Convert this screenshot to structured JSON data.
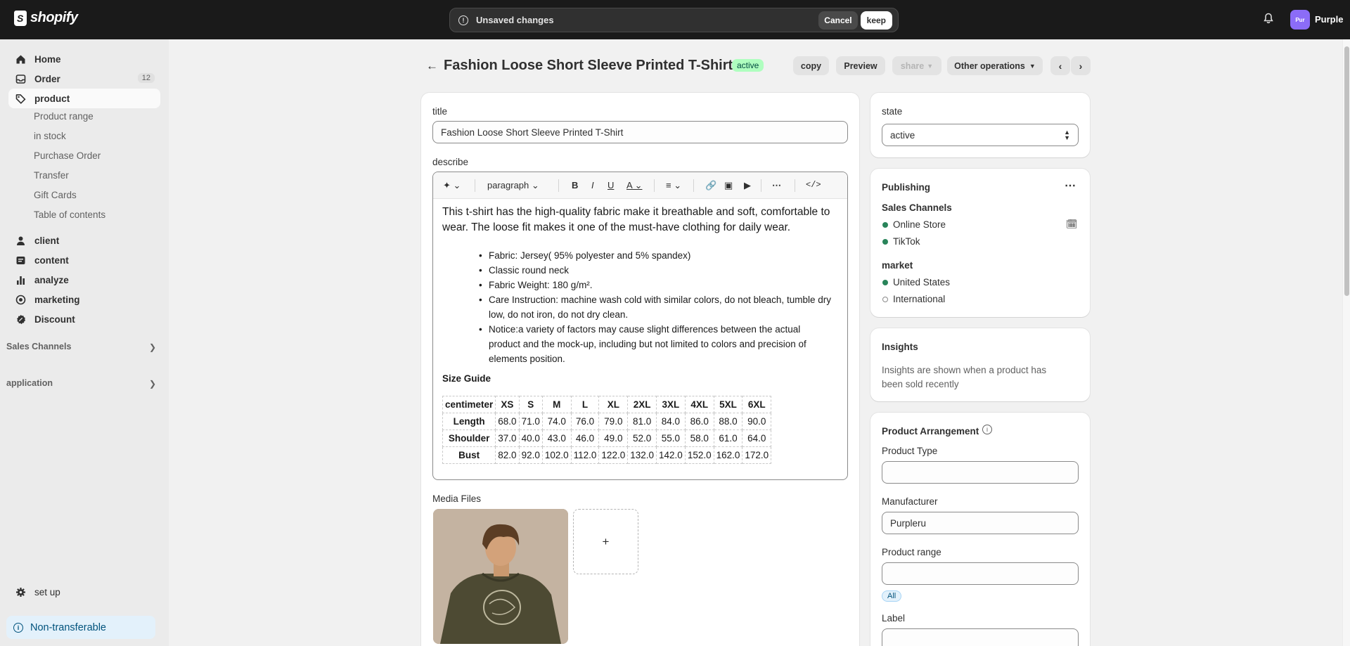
{
  "topbar": {
    "logo_text": "shopify",
    "unsaved_message": "Unsaved changes",
    "cancel_label": "Cancel",
    "keep_label": "keep",
    "avatar_initials": "Pur",
    "store_name": "Purple"
  },
  "sidebar": {
    "items": [
      {
        "label": "Home",
        "icon": "home-icon"
      },
      {
        "label": "Order",
        "icon": "inbox-icon",
        "count": "12"
      },
      {
        "label": "product",
        "icon": "tag-icon",
        "active": true
      },
      {
        "label": "client",
        "icon": "person-icon"
      },
      {
        "label": "content",
        "icon": "content-icon"
      },
      {
        "label": "analyze",
        "icon": "bar-chart-icon"
      },
      {
        "label": "marketing",
        "icon": "target-icon"
      },
      {
        "label": "Discount",
        "icon": "discount-icon"
      }
    ],
    "sub_items": [
      "Product range",
      "in stock",
      "Purchase Order",
      "Transfer",
      "Gift Cards",
      "Table of contents"
    ],
    "sales_channels_label": "Sales Channels",
    "application_label": "application",
    "setup_label": "set up",
    "non_transferable_label": "Non-transferable"
  },
  "header": {
    "title": "Fashion Loose Short Sleeve Printed T-Shirt",
    "status": "active",
    "buttons": {
      "copy": "copy",
      "preview": "Preview",
      "share": "share",
      "other": "Other operations"
    }
  },
  "main": {
    "title_label": "title",
    "title_value": "Fashion Loose Short Sleeve Printed T-Shirt",
    "describe_label": "describe",
    "toolbar": {
      "paragraph": "paragraph"
    },
    "description": {
      "intro": "This t-shirt has the high-quality fabric make it breathable and soft, comfortable to wear. The loose fit makes it one of the must-have clothing for daily wear.",
      "bullets": [
        "Fabric: Jersey( 95% polyester and 5% spandex)",
        "Classic round neck",
        "Fabric Weight: 180 g/m².",
        "Care Instruction: machine wash cold with similar colors, do not bleach, tumble dry low, do not iron, do not dry clean.",
        "Notice:a variety of factors may cause slight differences between the actual product and the mock-up, including but not limited to colors and precision of elements position."
      ],
      "size_guide_title": "Size Guide",
      "size_table": {
        "headers": [
          "centimeter",
          "XS",
          "S",
          "M",
          "L",
          "XL",
          "2XL",
          "3XL",
          "4XL",
          "5XL",
          "6XL"
        ],
        "rows": [
          [
            "Length",
            "68.0",
            "71.0",
            "74.0",
            "76.0",
            "79.0",
            "81.0",
            "84.0",
            "86.0",
            "88.0",
            "90.0"
          ],
          [
            "Shoulder",
            "37.0",
            "40.0",
            "43.0",
            "46.0",
            "49.0",
            "52.0",
            "55.0",
            "58.0",
            "61.0",
            "64.0"
          ],
          [
            "Bust",
            "82.0",
            "92.0",
            "102.0",
            "112.0",
            "122.0",
            "132.0",
            "142.0",
            "152.0",
            "162.0",
            "172.0"
          ]
        ]
      }
    },
    "media_label": "Media Files",
    "add_media_symbol": "+"
  },
  "right": {
    "state_label": "state",
    "state_value": "active",
    "publishing_label": "Publishing",
    "sales_channels_label": "Sales Channels",
    "channels": [
      "Online Store",
      "TikTok"
    ],
    "market_label": "market",
    "markets": [
      "United States",
      "International"
    ],
    "insights_label": "Insights",
    "insights_text": "Insights are shown when a product has been sold recently",
    "arrangement_label": "Product Arrangement",
    "product_type_label": "Product Type",
    "product_type_value": "",
    "manufacturer_label": "Manufacturer",
    "manufacturer_value": "Purpleru",
    "product_range_label": "Product range",
    "product_range_value": "",
    "all_chip": "All",
    "label_label": "Label"
  },
  "colors": {
    "topbar": "#1a1a1a",
    "active_badge_bg": "#affebf",
    "status_dot": "#29845a",
    "avatar": "#8b6cf7",
    "info_blue": "#00527c"
  }
}
